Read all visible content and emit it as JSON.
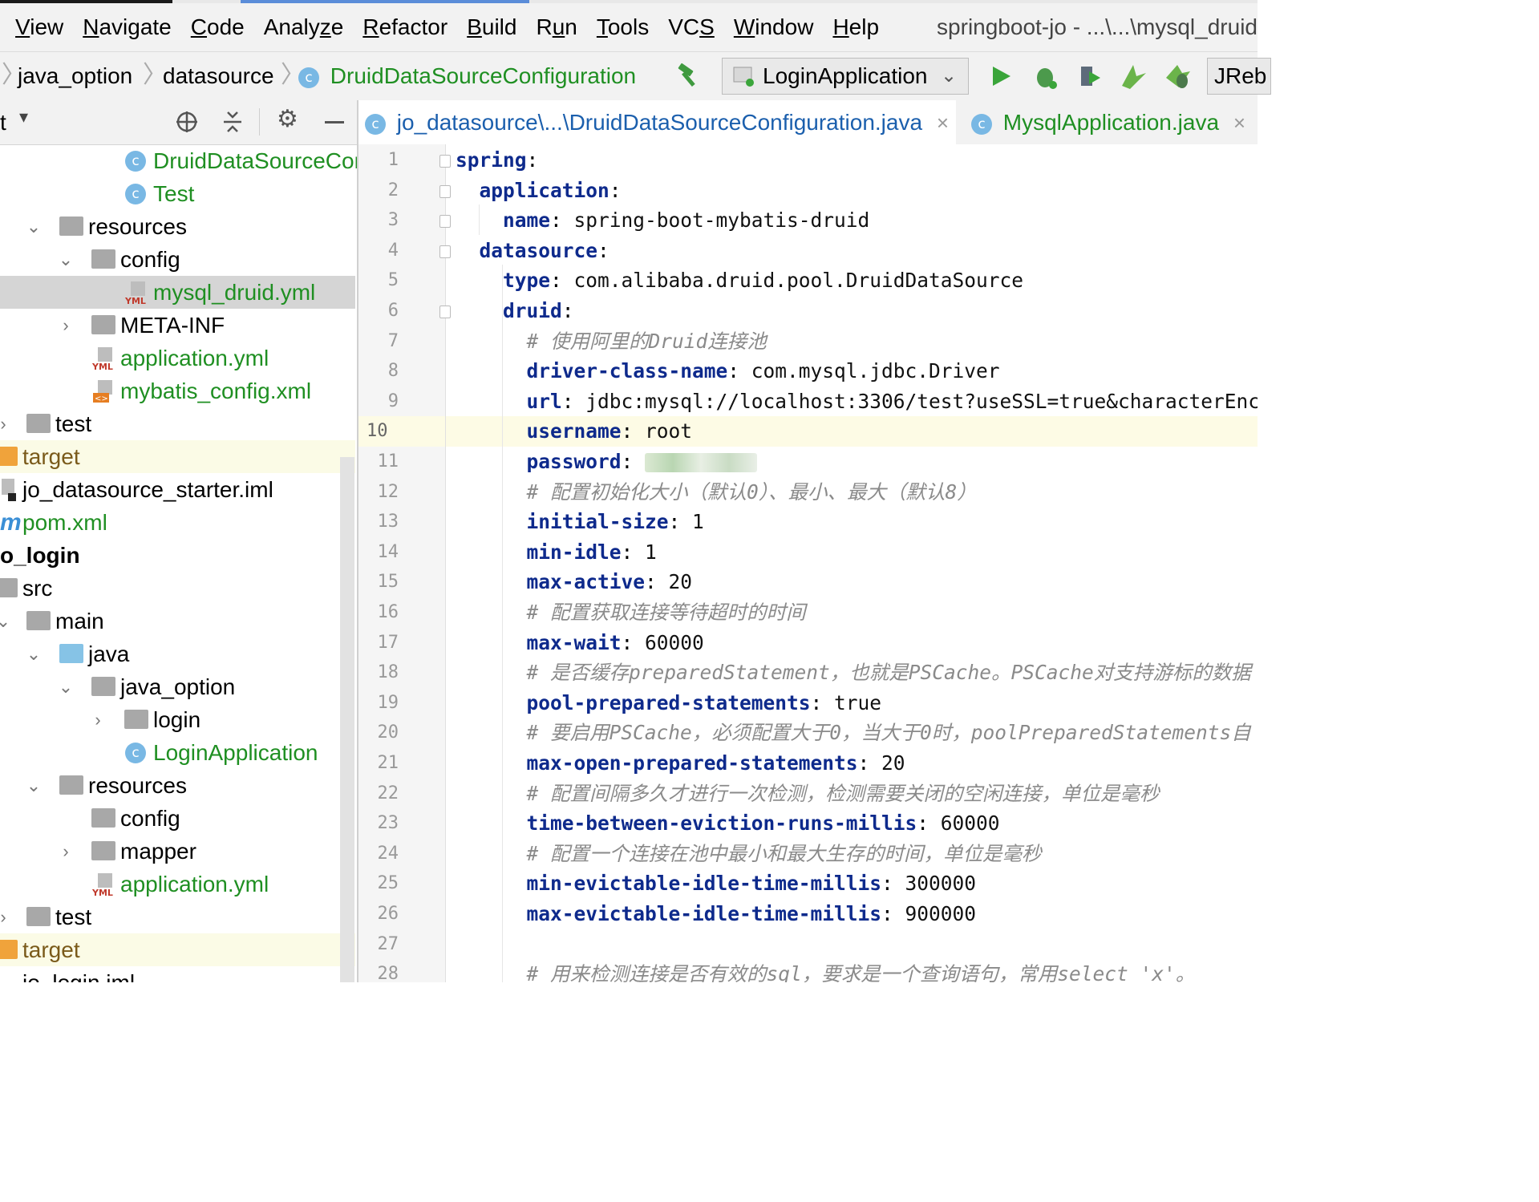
{
  "menu": [
    {
      "pre": "",
      "ul": "V",
      "post": "iew"
    },
    {
      "pre": "",
      "ul": "N",
      "post": "avigate"
    },
    {
      "pre": "",
      "ul": "C",
      "post": "ode"
    },
    {
      "pre": "Analy",
      "ul": "z",
      "post": "e"
    },
    {
      "pre": "",
      "ul": "R",
      "post": "efactor"
    },
    {
      "pre": "",
      "ul": "B",
      "post": "uild"
    },
    {
      "pre": "R",
      "ul": "u",
      "post": "n"
    },
    {
      "pre": "",
      "ul": "T",
      "post": "ools"
    },
    {
      "pre": "VC",
      "ul": "S",
      "post": ""
    },
    {
      "pre": "",
      "ul": "W",
      "post": "indow"
    },
    {
      "pre": "",
      "ul": "H",
      "post": "elp"
    }
  ],
  "window_title": "springboot-jo - ...\\...\\mysql_druid",
  "breadcrumb": [
    "java_option",
    "datasource",
    "DruidDataSourceConfiguration"
  ],
  "run_config": "LoginApplication",
  "jrebel_label": "JReb",
  "project_panel": {
    "title": "t"
  },
  "tree": {
    "r0": "DruidDataSourceCon",
    "r1": "Test",
    "r2": "resources",
    "r3": "config",
    "r4": "mysql_druid.yml",
    "r5": "META-INF",
    "r6": "application.yml",
    "r7": "mybatis_config.xml",
    "r8": "test",
    "r9": "target",
    "r10": "jo_datasource_starter.iml",
    "r11": "pom.xml",
    "r12": "o_login",
    "r13": "src",
    "r14": "main",
    "r15": "java",
    "r16": "java_option",
    "r17": "login",
    "r18": "LoginApplication",
    "r19": "resources",
    "r20": "config",
    "r21": "mapper",
    "r22": "application.yml",
    "r23": "test",
    "r24": "target",
    "r25": "jo_login.iml"
  },
  "tabs": [
    {
      "label": "jo_datasource\\...\\DruidDataSourceConfiguration.java"
    },
    {
      "label": "MysqlApplication.java"
    }
  ],
  "current_line": 10,
  "code_lines": [
    {
      "n": "1",
      "indent": "",
      "key": "spring",
      "val": "",
      "cmt": ""
    },
    {
      "n": "2",
      "indent": "  ",
      "key": "application",
      "val": "",
      "cmt": ""
    },
    {
      "n": "3",
      "indent": "    ",
      "key": "name",
      "val": "spring-boot-mybatis-druid",
      "cmt": ""
    },
    {
      "n": "4",
      "indent": "  ",
      "key": "datasource",
      "val": "",
      "cmt": ""
    },
    {
      "n": "5",
      "indent": "    ",
      "key": "type",
      "val": "com.alibaba.druid.pool.DruidDataSource",
      "cmt": ""
    },
    {
      "n": "6",
      "indent": "    ",
      "key": "druid",
      "val": "",
      "cmt": ""
    },
    {
      "n": "7",
      "indent": "      ",
      "key": "",
      "val": "",
      "cmt": "# 使用阿里的Druid连接池"
    },
    {
      "n": "8",
      "indent": "      ",
      "key": "driver-class-name",
      "val": "com.mysql.jdbc.Driver",
      "cmt": ""
    },
    {
      "n": "9",
      "indent": "      ",
      "key": "url",
      "val": "jdbc:mysql://localhost:3306/test?useSSL=true&characterEnc",
      "cmt": ""
    },
    {
      "n": "10",
      "indent": "      ",
      "key": "username",
      "val": "root",
      "cmt": ""
    },
    {
      "n": "11",
      "indent": "      ",
      "key": "password",
      "val": "",
      "cmt": "",
      "masked": true
    },
    {
      "n": "12",
      "indent": "      ",
      "key": "",
      "val": "",
      "cmt": "# 配置初始化大小（默认0）、最小、最大（默认8）"
    },
    {
      "n": "13",
      "indent": "      ",
      "key": "initial-size",
      "val": "1",
      "cmt": ""
    },
    {
      "n": "14",
      "indent": "      ",
      "key": "min-idle",
      "val": "1",
      "cmt": ""
    },
    {
      "n": "15",
      "indent": "      ",
      "key": "max-active",
      "val": "20",
      "cmt": ""
    },
    {
      "n": "16",
      "indent": "      ",
      "key": "",
      "val": "",
      "cmt": "# 配置获取连接等待超时的时间"
    },
    {
      "n": "17",
      "indent": "      ",
      "key": "max-wait",
      "val": "60000",
      "cmt": ""
    },
    {
      "n": "18",
      "indent": "      ",
      "key": "",
      "val": "",
      "cmt": "# 是否缓存preparedStatement，也就是PSCache。PSCache对支持游标的数据"
    },
    {
      "n": "19",
      "indent": "      ",
      "key": "pool-prepared-statements",
      "val": "true",
      "cmt": ""
    },
    {
      "n": "20",
      "indent": "      ",
      "key": "",
      "val": "",
      "cmt": "# 要启用PSCache，必须配置大于0，当大于0时，poolPreparedStatements自"
    },
    {
      "n": "21",
      "indent": "      ",
      "key": "max-open-prepared-statements",
      "val": "20",
      "cmt": ""
    },
    {
      "n": "22",
      "indent": "      ",
      "key": "",
      "val": "",
      "cmt": "# 配置间隔多久才进行一次检测，检测需要关闭的空闲连接，单位是毫秒"
    },
    {
      "n": "23",
      "indent": "      ",
      "key": "time-between-eviction-runs-millis",
      "val": "60000",
      "cmt": ""
    },
    {
      "n": "24",
      "indent": "      ",
      "key": "",
      "val": "",
      "cmt": "# 配置一个连接在池中最小和最大生存的时间，单位是毫秒"
    },
    {
      "n": "25",
      "indent": "      ",
      "key": "min-evictable-idle-time-millis",
      "val": "300000",
      "cmt": ""
    },
    {
      "n": "26",
      "indent": "      ",
      "key": "max-evictable-idle-time-millis",
      "val": "900000",
      "cmt": ""
    },
    {
      "n": "27",
      "indent": "",
      "key": "",
      "val": "",
      "cmt": ""
    },
    {
      "n": "28",
      "indent": "      ",
      "key": "",
      "val": "",
      "cmt": "# 用来检测连接是否有效的sql，要求是一个查询语句，常用select 'x'。"
    }
  ]
}
